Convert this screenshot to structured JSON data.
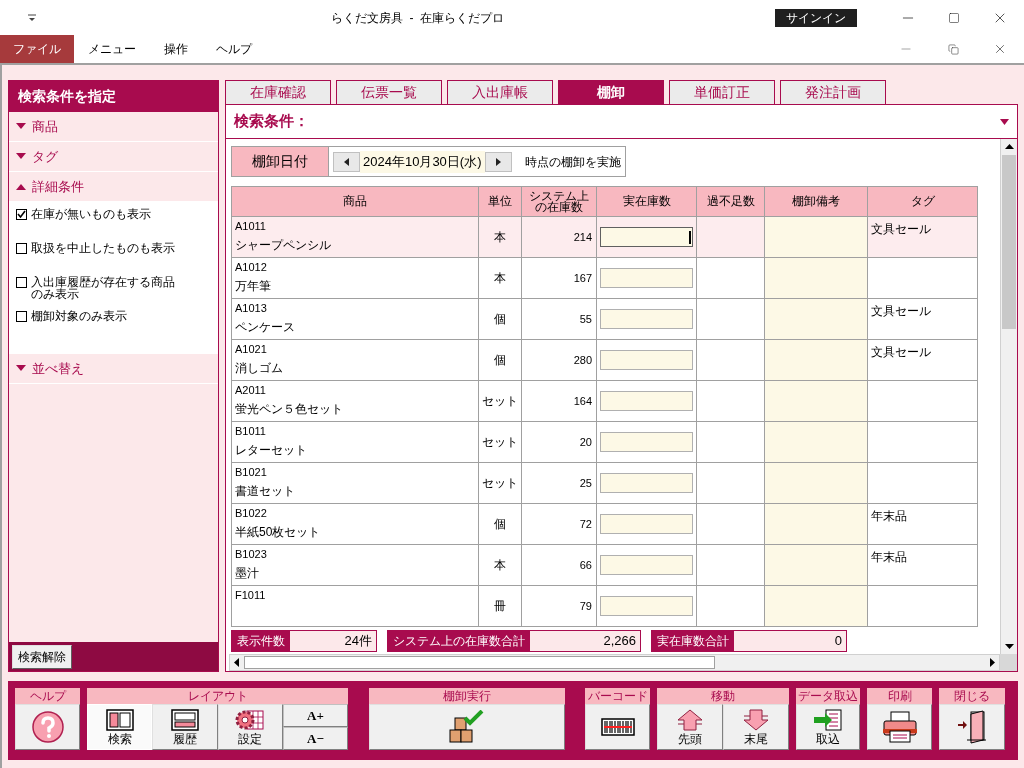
{
  "window": {
    "title": "らくだ文房具  -  在庫らくだプロ",
    "sign_in": "サインイン"
  },
  "menu": [
    {
      "label": "ファイル",
      "selected": true
    },
    {
      "label": "メニュー",
      "selected": false
    },
    {
      "label": "操作",
      "selected": false
    },
    {
      "label": "ヘルプ",
      "selected": false
    }
  ],
  "search_panel": {
    "title": "検索条件を指定",
    "sections": [
      {
        "label": "商品",
        "expanded": false
      },
      {
        "label": "タグ",
        "expanded": false
      },
      {
        "label": "詳細条件",
        "expanded": true,
        "options": [
          {
            "label": "在庫が無いものも表示",
            "checked": true
          },
          {
            "label": "取扱を中止したものも表示",
            "checked": false
          },
          {
            "label": "入出庫履歴が存在する商品のみ表示",
            "checked": false
          },
          {
            "label": "棚卸対象のみ表示",
            "checked": false
          }
        ]
      },
      {
        "label": "並べ替え",
        "expanded": false
      }
    ],
    "clear_button": "検索解除"
  },
  "tabs": [
    {
      "label": "在庫確認",
      "selected": false
    },
    {
      "label": "伝票一覧",
      "selected": false
    },
    {
      "label": "入出庫帳",
      "selected": false
    },
    {
      "label": "棚卸",
      "selected": true
    },
    {
      "label": "単価訂正",
      "selected": false
    },
    {
      "label": "発注計画",
      "selected": false
    }
  ],
  "filter_bar": {
    "label": "検索条件："
  },
  "date": {
    "label": "棚卸日付",
    "value": "2024年10月30日(水)",
    "suffix": "時点の棚卸を実施"
  },
  "table": {
    "columns": [
      "商品",
      "単位",
      "システム上の在庫数",
      "実在庫数",
      "過不足数",
      "棚卸備考",
      "タグ"
    ],
    "rows": [
      {
        "code": "A1011",
        "name": "シャープペンシル",
        "unit": "本",
        "system_stock": "214",
        "tag": "文具セール",
        "selected": true
      },
      {
        "code": "A1012",
        "name": "万年筆",
        "unit": "本",
        "system_stock": "167",
        "selected": false
      },
      {
        "code": "A1013",
        "name": "ペンケース",
        "unit": "個",
        "system_stock": "55",
        "tag": "文具セール",
        "selected": false
      },
      {
        "code": "A1021",
        "name": "消しゴム",
        "unit": "個",
        "system_stock": "280",
        "tag": "文具セール",
        "selected": false
      },
      {
        "code": "A2011",
        "name": "蛍光ペン５色セット",
        "unit": "セット",
        "system_stock": "164",
        "selected": false
      },
      {
        "code": "B1011",
        "name": "レターセット",
        "unit": "セット",
        "system_stock": "20",
        "selected": false
      },
      {
        "code": "B1021",
        "name": "書道セット",
        "unit": "セット",
        "system_stock": "25",
        "selected": false
      },
      {
        "code": "B1022",
        "name": "半紙50枚セット",
        "unit": "個",
        "system_stock": "72",
        "tag": "年末品",
        "selected": false
      },
      {
        "code": "B1023",
        "name": "墨汁",
        "unit": "本",
        "system_stock": "66",
        "tag": "年末品",
        "selected": false
      },
      {
        "code": "F1011",
        "unit": "冊",
        "system_stock": "79",
        "selected": false
      }
    ]
  },
  "totals": [
    {
      "label": "表示件数",
      "value": "24件"
    },
    {
      "label": "システム上の在庫数合計",
      "value": "2,266"
    },
    {
      "label": "実在庫数合計",
      "value": "0"
    }
  ],
  "toolbar": [
    {
      "label": "ヘルプ",
      "buttons": [
        {
          "kind": "help"
        }
      ]
    },
    {
      "label": "レイアウト",
      "buttons": [
        {
          "kind": "layout-search",
          "label": "検索",
          "selected": true
        },
        {
          "kind": "layout-history",
          "label": "履歴",
          "selected": false
        },
        {
          "kind": "settings",
          "label": "設定",
          "selected": false
        },
        {
          "kind": "stack",
          "items": [
            "A+",
            "A−"
          ]
        }
      ]
    },
    {
      "label": "棚卸実行",
      "buttons": [
        {
          "kind": "inventory"
        }
      ]
    },
    {
      "label": "バーコード",
      "buttons": [
        {
          "kind": "barcode"
        }
      ]
    },
    {
      "label": "移動",
      "buttons": [
        {
          "kind": "first",
          "label": "先頭"
        },
        {
          "kind": "last",
          "label": "末尾"
        }
      ]
    },
    {
      "label": "データ取込",
      "buttons": [
        {
          "kind": "import",
          "label": "取込"
        }
      ]
    },
    {
      "label": "印刷",
      "buttons": [
        {
          "kind": "print"
        }
      ]
    },
    {
      "label": "閉じる",
      "buttons": [
        {
          "kind": "close"
        }
      ]
    }
  ]
}
